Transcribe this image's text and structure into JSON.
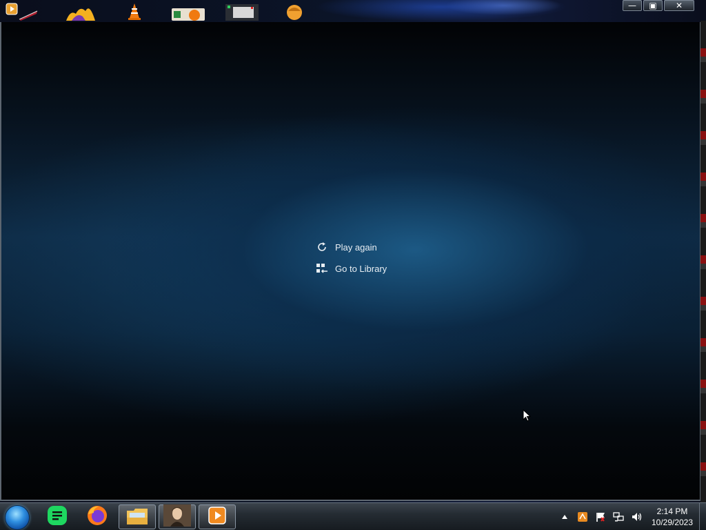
{
  "menu": {
    "items": [
      {
        "label": "Play again",
        "icon": "refresh-icon"
      },
      {
        "label": "Go to Library",
        "icon": "library-icon"
      }
    ]
  },
  "window": {
    "minimize_glyph": "—",
    "maximize_glyph": "▣",
    "close_glyph": "✕"
  },
  "desktop_icons": [
    "media-player-icon",
    "pen-icon",
    "weather-icon",
    "vlc-icon",
    "image-icon",
    "screen-icon",
    "avatar-icon"
  ],
  "taskbar": {
    "apps": [
      {
        "name": "spotify-icon",
        "active": false
      },
      {
        "name": "firefox-icon",
        "active": false
      },
      {
        "name": "file-explorer-icon",
        "active": true
      },
      {
        "name": "photo-viewer-icon",
        "active": true
      },
      {
        "name": "media-player-icon",
        "active": true
      }
    ]
  },
  "tray": {
    "icons": [
      "show-hidden-icon",
      "app-tray-icon",
      "action-center-icon",
      "network-icon",
      "volume-icon"
    ],
    "time": "2:14 PM",
    "date": "10/29/2023"
  },
  "colors": {
    "menu_text": "#e8eef3",
    "window_bg": "#0e2a44"
  }
}
